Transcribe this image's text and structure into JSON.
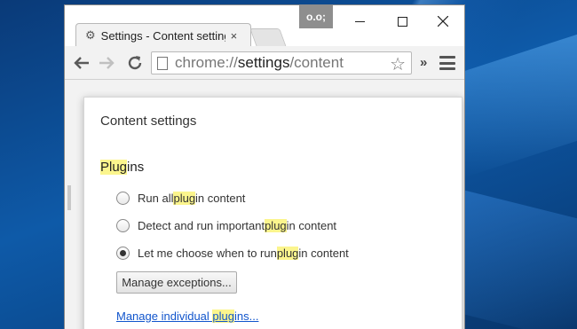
{
  "window": {
    "tab_title": "Settings - Content setting",
    "tab_close": "×",
    "incognito_label": "o.o;"
  },
  "toolbar": {
    "url_scheme": "chrome://",
    "url_host": "settings",
    "url_path": "/content",
    "overflow_label": "»"
  },
  "dialog": {
    "title": "Content settings",
    "section": {
      "title_highlight": "Plug",
      "title_rest": "ins"
    },
    "options": [
      {
        "before": "Run all ",
        "highlight": "plug",
        "after": "in content",
        "selected": false
      },
      {
        "before": "Detect and run important ",
        "highlight": "plug",
        "after": "in content",
        "selected": false
      },
      {
        "before": "Let me choose when to run ",
        "highlight": "plug",
        "after": "in content",
        "selected": true
      }
    ],
    "manage_exceptions": "Manage exceptions...",
    "link": {
      "before": "Manage individual ",
      "highlight": "plug",
      "after": "ins..."
    }
  },
  "colors": {
    "highlight": "#fbf58d",
    "link": "#1155cc",
    "desktop": "#0f4f93"
  }
}
